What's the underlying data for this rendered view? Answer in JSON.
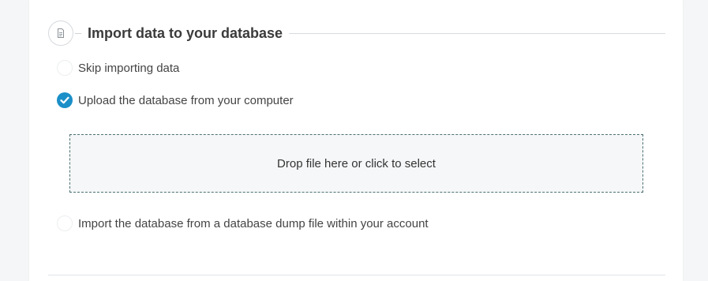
{
  "section": {
    "title": "Import data to your database",
    "icon": "document-icon"
  },
  "options": [
    {
      "label": "Skip importing data",
      "checked": false
    },
    {
      "label": "Upload the database from your computer",
      "checked": true
    },
    {
      "label": "Import the database from a database dump file within your account",
      "checked": false
    }
  ],
  "dropzone": {
    "text": "Drop file here or click to select"
  },
  "colors": {
    "accent": "#1b8fc8",
    "dropzone_border": "#4a7070",
    "background": "#f5f6f7"
  }
}
